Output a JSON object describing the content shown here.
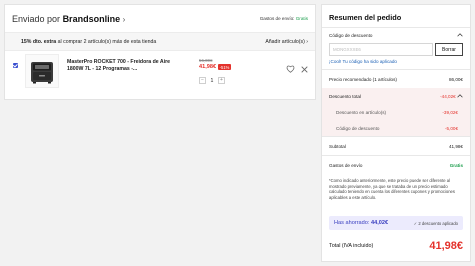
{
  "cart": {
    "seller_prefix": "Enviado por",
    "seller_name": "Brandsonline",
    "shipping_label": "Gastos de envío:",
    "shipping_value": "Gratis",
    "promo_text_bold": "15% dto. extra",
    "promo_text_rest": " al comprar 2 artículo(s) más de esta tienda",
    "promo_add": "Añadir artículo(s) ›",
    "item": {
      "selected": true,
      "title": "MasterPro ROCKET 700 - Freidora de Aire 1800W 7L - 12 Programas -...",
      "old_price": "56,00€",
      "new_price": "41,98€",
      "discount_badge": "-51%",
      "quantity": "1",
      "minus": "−",
      "plus": "+"
    }
  },
  "summary": {
    "title": "Resumen del pedido",
    "code_section_label": "Código de descuento",
    "code_input_value": "MONGXXXE6",
    "code_remove_button": "Borrar",
    "code_applied_msg": "¡Cool! Tu código ha sido aplicado",
    "recommended_label": "Precio recomendado (1 artículos)",
    "recommended_value": "86,00€",
    "total_discount_label": "Descuento total",
    "total_discount_value": "-44,02€",
    "item_discount_label": "Descuento en artículo(s)",
    "item_discount_value": "-39,02€",
    "code_discount_label": "Código de descuento",
    "code_discount_value": "-5,00€",
    "subtotal_label": "Subtotal",
    "subtotal_value": "41,98€",
    "shipping_label": "Gastos de envío",
    "shipping_value": "Gratis",
    "note": "*Como indicado anteriormente, este precio puede ser diferente al mostrado previamente, ya que se trataba de un precio estimado calculado teniendo en cuenta los diferentes cupones y promociones aplicables a este artículo.",
    "saved_prefix": "Has ahorrado:",
    "saved_amount": "44,02€",
    "saved_note": "✓ 2 descuento aplicado",
    "total_label": "Total (IVA incluido)",
    "total_value": "41,98€"
  },
  "colors": {
    "accent_red": "#e4322c",
    "free_green": "#1a9d4b",
    "check_blue": "#3a4fd0",
    "saved_bg": "#ecebfd"
  }
}
